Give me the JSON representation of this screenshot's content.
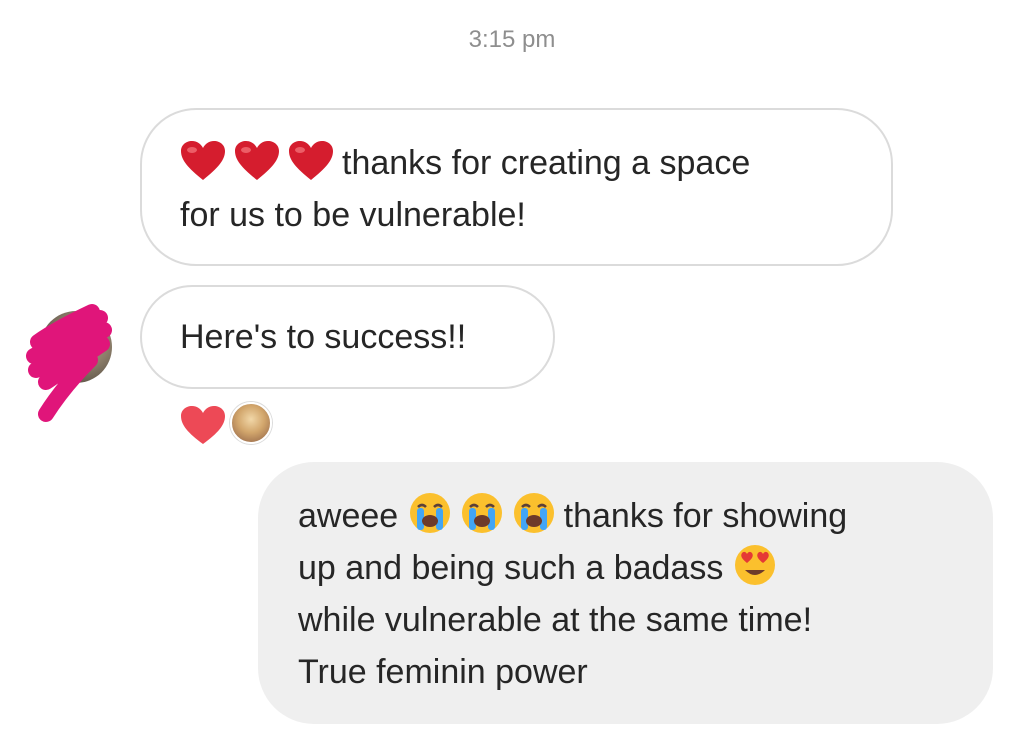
{
  "conversation": {
    "timestamp": "3:15 pm",
    "messages": [
      {
        "direction": "received",
        "emoji": [
          "red-heart",
          "red-heart",
          "red-heart"
        ],
        "line1": "thanks for creating a space",
        "line2": "for us to be vulnerable!"
      },
      {
        "direction": "received",
        "text": "Here's to success!!",
        "reaction": "red-heart"
      },
      {
        "direction": "sent",
        "line1_start": "aweee",
        "line1_emoji": [
          "loudly-crying-face",
          "loudly-crying-face",
          "loudly-crying-face"
        ],
        "line1_end": "thanks for showing",
        "line2_start": "up and being such a badass",
        "line2_emoji": "heart-eyes-face",
        "line3": "while vulnerable at the same time!",
        "line4": "True feminin power"
      }
    ]
  },
  "colors": {
    "received_bubble_border": "#dbdbdb",
    "sent_bubble_bg": "#efefef",
    "timestamp_text": "#8e8e8e",
    "heart_red": "#e0243a",
    "reaction_heart": "#ed4956",
    "redaction_scribble": "#e0157a"
  }
}
